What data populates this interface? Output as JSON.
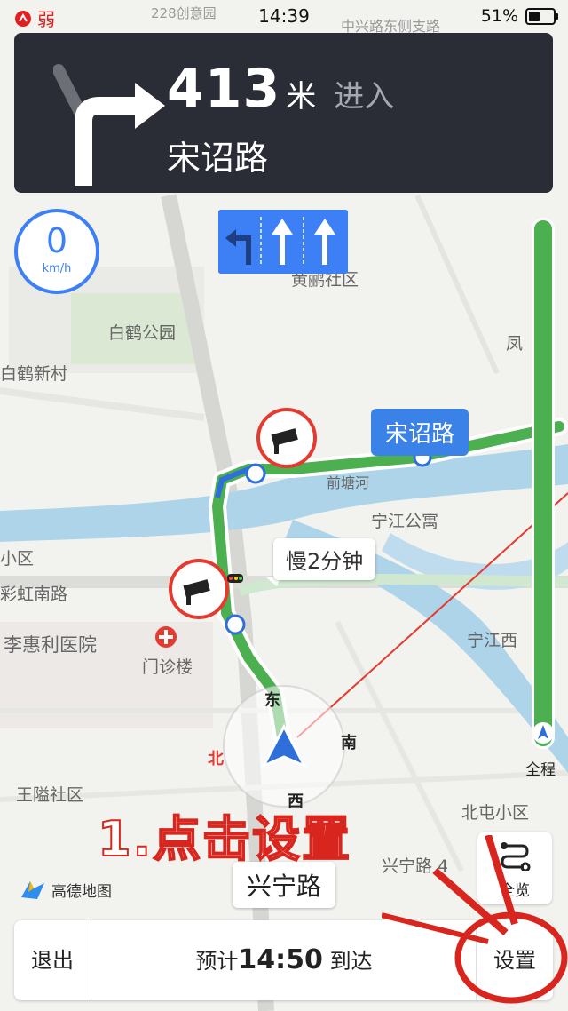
{
  "status_bar": {
    "signal": "弱",
    "time": "14:39",
    "battery": "51%",
    "street_hint": "中兴路东侧支路",
    "street_hint2": "228创意园"
  },
  "nav": {
    "distance": "413",
    "unit": "米",
    "action": "进入",
    "road": "宋诏路"
  },
  "speed": {
    "value": "0",
    "unit": "km/h"
  },
  "route": {
    "progress_label": "全程",
    "road_callout": "宋诏路",
    "delay_callout": "慢2分钟",
    "current_road": "兴宁路"
  },
  "map_labels": {
    "p1": "黄鹂社区",
    "p2": "白鹤公园",
    "p3": "白鹤新村",
    "p4": "前塘河",
    "p5": "宁江公寓",
    "p6": "彩虹南路",
    "p7": "李惠利医院",
    "p8": "门诊楼",
    "p9": "宁江西",
    "p10": "王隘社区",
    "p11": "北屯小区",
    "p12": "凤",
    "p13": "小区",
    "p14": "兴宁路 4"
  },
  "compass": {
    "east": "东",
    "south": "南",
    "west": "西",
    "north": "北"
  },
  "logo": "高德地图",
  "overview": "全览",
  "bottom": {
    "exit": "退出",
    "eta_prefix": "预计",
    "eta_time": "14:50",
    "eta_suffix": "到达",
    "settings": "设置"
  },
  "annotation": "1.点击设置",
  "colors": {
    "route_green": "#4caf50",
    "accent_blue": "#3d80f5",
    "annotation_red": "#d8261e",
    "card_dark": "#2a2d36"
  }
}
